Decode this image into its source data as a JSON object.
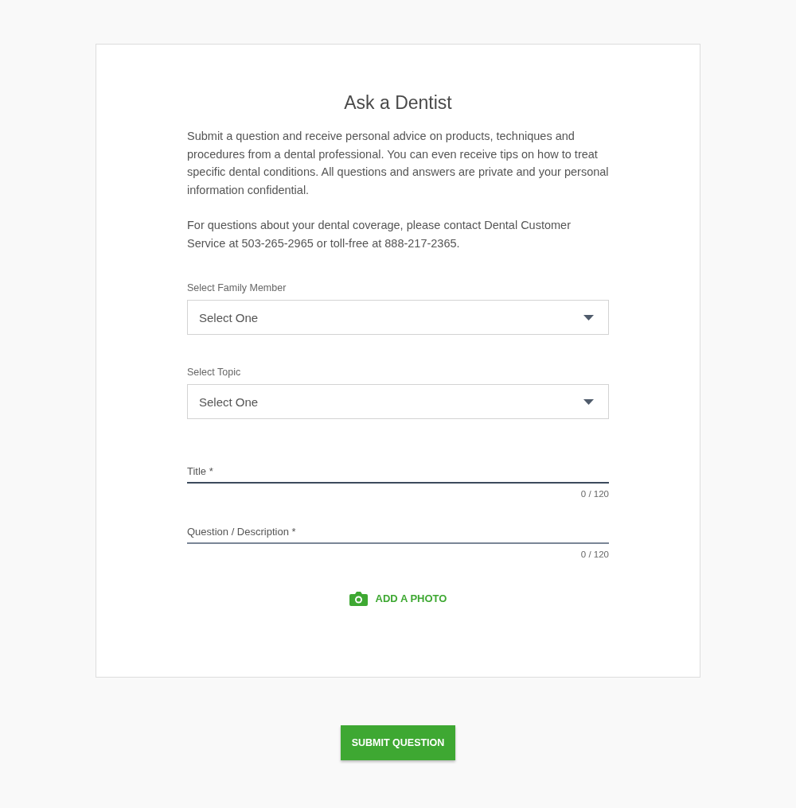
{
  "title": "Ask a Dentist",
  "paragraphs": [
    "Submit a question and receive personal advice on products, techniques and procedures from a dental professional. You can even receive tips on how to treat specific dental conditions. All questions and answers are private and your personal information confidential.",
    "For questions about your dental coverage, please contact Dental Customer Service at 503-265-2965 or toll-free at 888-217-2365."
  ],
  "fields": [
    {
      "kind": "select",
      "label": "Select Family Member",
      "value": "Select One"
    },
    {
      "kind": "select",
      "label": "Select Topic",
      "value": "Select One"
    },
    {
      "kind": "text",
      "placeholder": "Title *",
      "counter": "0 / 120"
    },
    {
      "kind": "text",
      "placeholder": "Question / Description *",
      "counter": "0 / 120"
    }
  ],
  "photo_link": "ADD A PHOTO",
  "submit_button": "SUBMIT QUESTION"
}
